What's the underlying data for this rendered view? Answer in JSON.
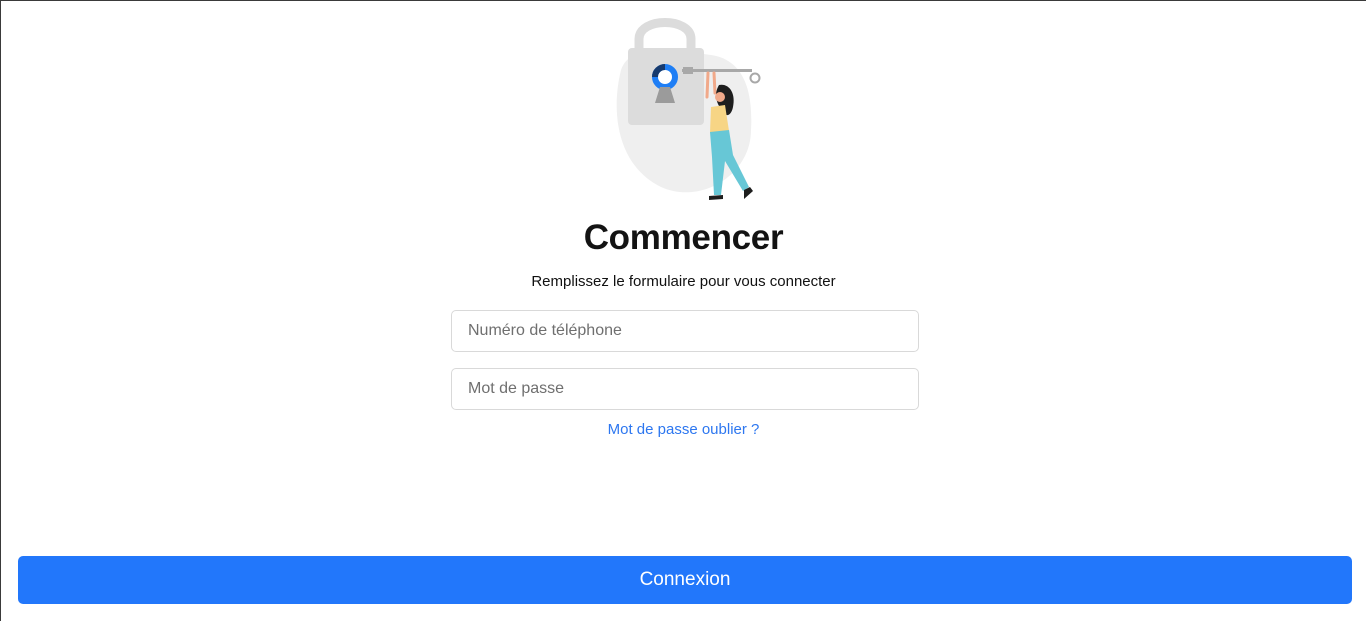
{
  "login": {
    "title": "Commencer",
    "subtitle": "Remplissez le formulaire pour vous connecter",
    "phone_placeholder": "Numéro de téléphone",
    "password_placeholder": "Mot de passe",
    "forgot_password": "Mot de passe oublier ?",
    "submit_label": "Connexion"
  },
  "illustration": {
    "name": "padlock-with-woman-holding-key"
  },
  "colors": {
    "accent": "#2277fb",
    "link": "#2d77f0",
    "title": "#131313",
    "field_border": "#d9d9d9",
    "illustration_blob": "#efefef",
    "padlock": "#dedede",
    "figure_shirt": "#f7d585",
    "figure_pants": "#67c7d6"
  }
}
